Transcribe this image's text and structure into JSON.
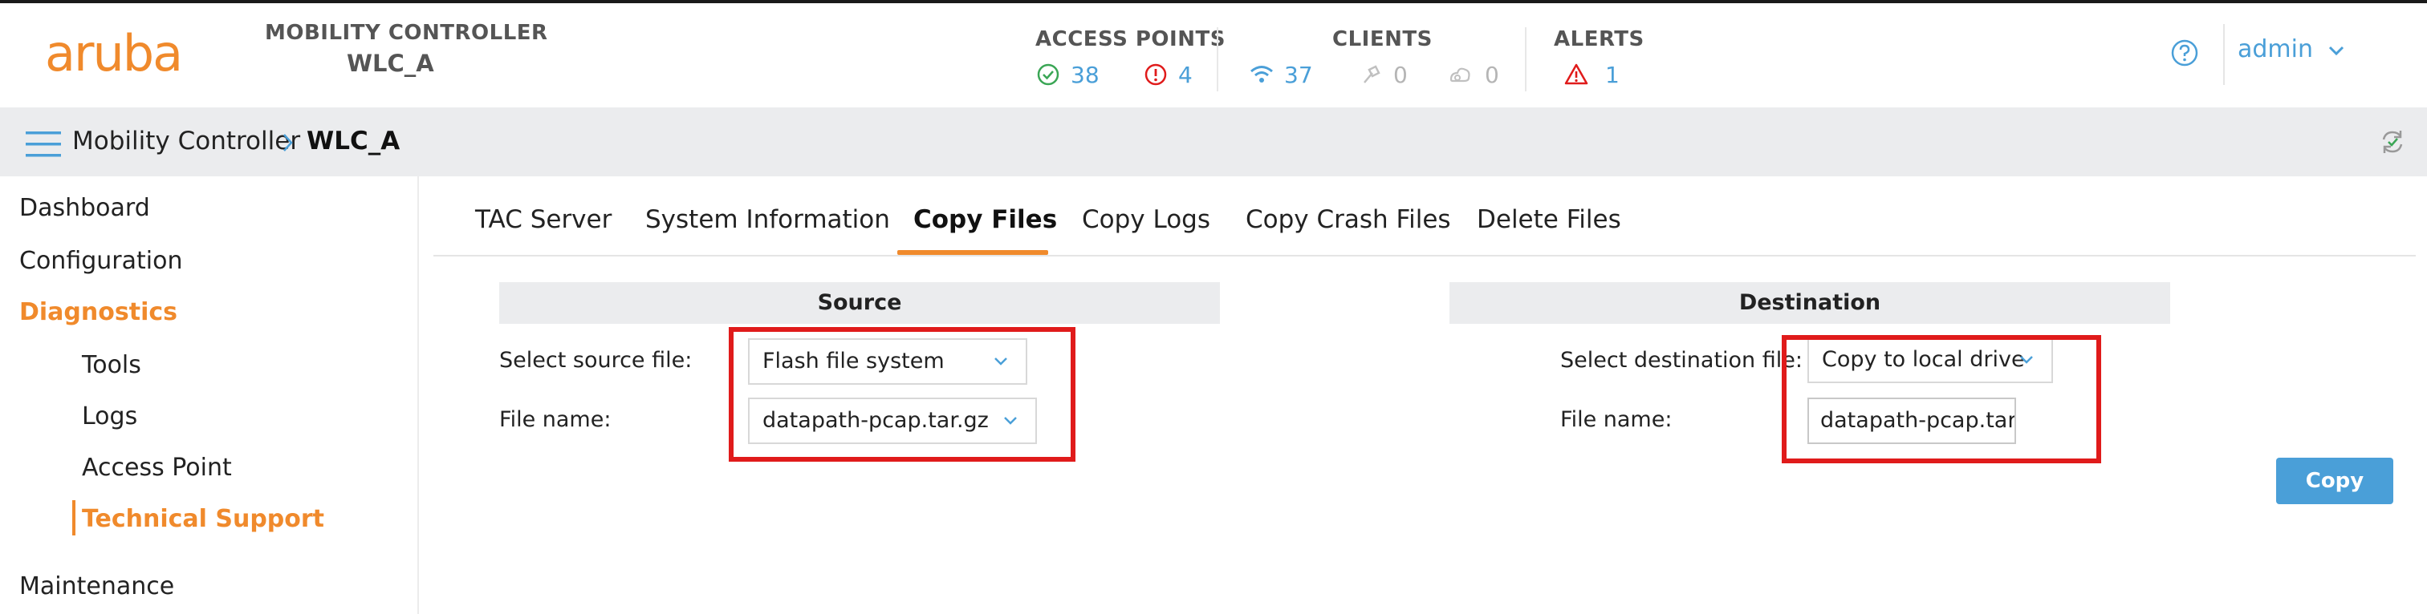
{
  "brand": {
    "logo_text": "aruba",
    "accent": "#f08a2c"
  },
  "controller": {
    "kind": "MOBILITY CONTROLLER",
    "name": "WLC_A"
  },
  "stats": {
    "access_points": {
      "title": "ACCESS POINTS",
      "up": "38",
      "down": "4"
    },
    "clients": {
      "title": "CLIENTS",
      "wireless": "37",
      "wired": "0",
      "remote": "0"
    },
    "alerts": {
      "title": "ALERTS",
      "count": "1"
    }
  },
  "user": {
    "name": "admin"
  },
  "breadcrumb": {
    "root": "Mobility Controller",
    "current": "WLC_A"
  },
  "sidebar": {
    "items": [
      {
        "label": "Dashboard"
      },
      {
        "label": "Configuration"
      },
      {
        "label": "Diagnostics"
      },
      {
        "label": "Maintenance"
      }
    ],
    "subitems": [
      {
        "label": "Tools"
      },
      {
        "label": "Logs"
      },
      {
        "label": "Access Point"
      },
      {
        "label": "Technical Support"
      }
    ]
  },
  "tabs": [
    {
      "label": "TAC Server"
    },
    {
      "label": "System Information"
    },
    {
      "label": "Copy Files"
    },
    {
      "label": "Copy Logs"
    },
    {
      "label": "Copy Crash Files"
    },
    {
      "label": "Delete Files"
    }
  ],
  "source": {
    "heading": "Source",
    "select_label": "Select source file:",
    "select_value": "Flash file system",
    "file_label": "File name:",
    "file_value": "datapath-pcap.tar.gz"
  },
  "destination": {
    "heading": "Destination",
    "select_label": "Select destination file:",
    "select_value": "Copy to local drive",
    "file_label": "File name:",
    "file_value": "datapath-pcap.tar.gz"
  },
  "actions": {
    "copy_label": "Copy"
  },
  "colors": {
    "link": "#4a9fd8",
    "ok": "#3aa655",
    "danger": "#e01b1b",
    "highlight_box": "#e01b1b"
  }
}
